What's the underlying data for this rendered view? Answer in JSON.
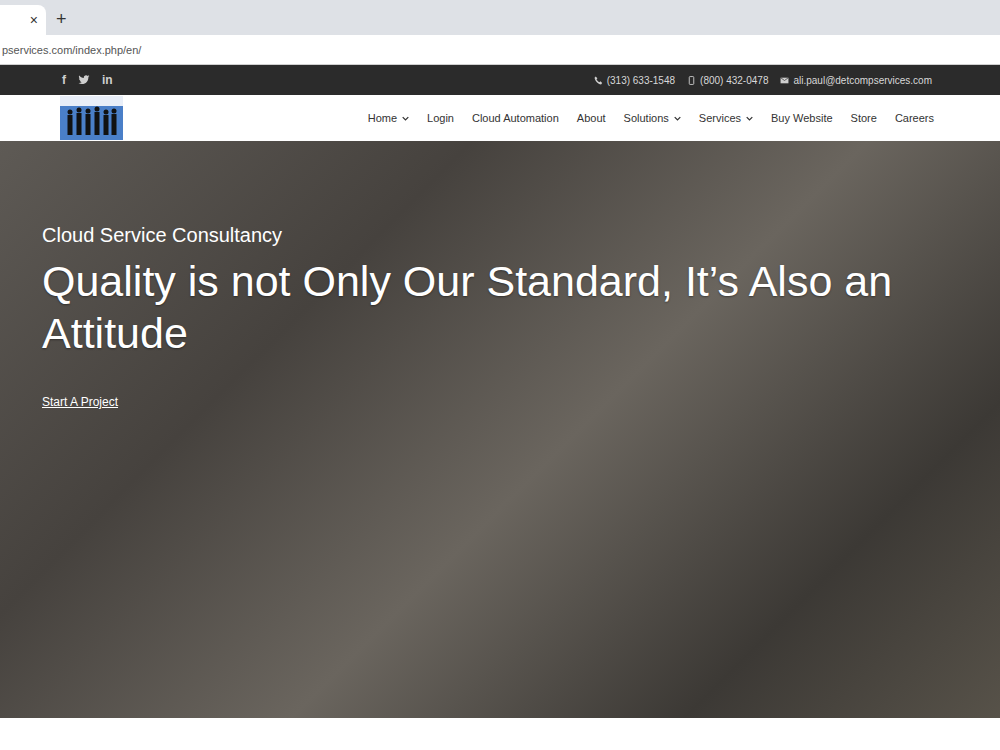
{
  "browser": {
    "tab_close": "×",
    "new_tab": "+",
    "address": "pservices.com/index.php/en/"
  },
  "top_bar": {
    "social": [
      {
        "kind": "glyph",
        "label": "f"
      },
      {
        "kind": "bird"
      },
      {
        "kind": "glyph",
        "label": "in"
      }
    ],
    "contacts": [
      {
        "kind": "phone",
        "label": "(313) 633-1548"
      },
      {
        "kind": "mobile",
        "label": "(800) 432-0478"
      },
      {
        "kind": "mail",
        "label": "ali.paul@detcompservices.com"
      }
    ]
  },
  "nav": {
    "items": [
      {
        "label": "Home",
        "dropdown": true
      },
      {
        "label": "Login",
        "dropdown": false
      },
      {
        "label": "Cloud Automation",
        "dropdown": false
      },
      {
        "label": "About",
        "dropdown": false
      },
      {
        "label": "Solutions",
        "dropdown": true
      },
      {
        "label": "Services",
        "dropdown": true
      },
      {
        "label": "Buy Website",
        "dropdown": false
      },
      {
        "label": "Store",
        "dropdown": false
      },
      {
        "label": "Careers",
        "dropdown": false
      }
    ]
  },
  "hero": {
    "kicker": "Cloud Service Consultancy",
    "title": "Quality is not Only Our Standard, It’s Also an Attitude",
    "link": "Start A Project"
  }
}
